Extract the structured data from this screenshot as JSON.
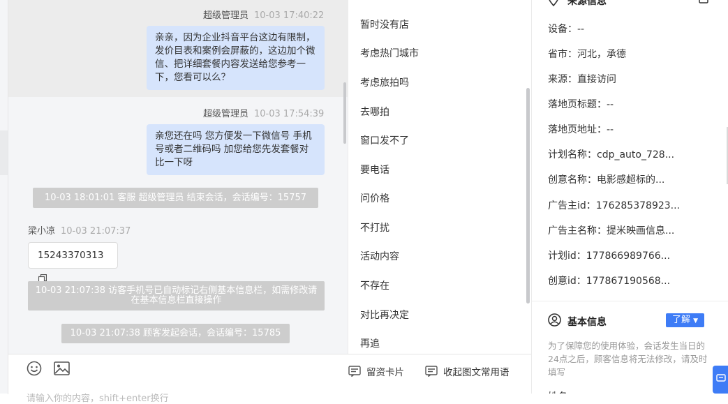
{
  "chat": {
    "messages": [
      {
        "sender": "超级管理员",
        "time": "10-03 17:40:22",
        "text": "亲亲，因为企业抖音平台这边有限制，发价目表和案例会屏蔽的，这边加个微信、把详细套餐内容发送给您参考一下，您看可以么？"
      },
      {
        "sender": "超级管理员",
        "time": "10-03 17:54:39",
        "text": "亲您还在吗 您方便发一下微信号 手机号或者二维码吗 加您给您先发套餐对比一下呀"
      }
    ],
    "system_end": "10-03 18:01:01 客服 超级管理员 结束会话，会话编号：15757",
    "customer": {
      "name": "梁小凉",
      "time": "10-03 21:07:37",
      "phone": "15243370313"
    },
    "system_phone_notice": "10-03 21:07:38 访客手机号已自动标记右侧基本信息栏，如需修改请在基本信息栏直接操作",
    "system_start": "10-03 21:07:38 顾客发起会话，会话编号：15785"
  },
  "toolbar": {
    "emoji_icon": "smiley-icon",
    "image_icon": "image-icon",
    "lead_card_label": "留资卡片",
    "collapse_phrases_label": "收起图文常用语",
    "input_placeholder": "请输入你的内容，shift+enter换行"
  },
  "quick_replies": [
    "暂时没有店",
    "考虑热门城市",
    "考虑旅拍吗",
    "去哪拍",
    "窗口发不了",
    "要电话",
    "问价格",
    "不打扰",
    "活动内容",
    "不存在",
    "对比再决定",
    "再追"
  ],
  "info": {
    "source_title": "来源信息",
    "source_rows": [
      "设备：--",
      "省市：河北，承德",
      "来源：直接访问",
      "落地页标题：--",
      "落地页地址：--",
      "计划名称：cdp_auto_728...",
      "创意名称：电影感超标的...",
      "广告主id：176285378923...",
      "广告主名称：提米映画信息...",
      "计划id：177866989766...",
      "创意id：177867190568..."
    ],
    "basic_title": "基本信息",
    "know_button": "了解",
    "basic_note": "为了保障您的使用体验，会话发生当日的24点之后，顾客信息将无法修改，请及时填写",
    "next_label": "姓名"
  },
  "colors": {
    "accent": "#3e7cf6",
    "bubble": "#d6e4fc",
    "system": "#cdcdcd",
    "chat_bg": "#f4f5f7"
  }
}
